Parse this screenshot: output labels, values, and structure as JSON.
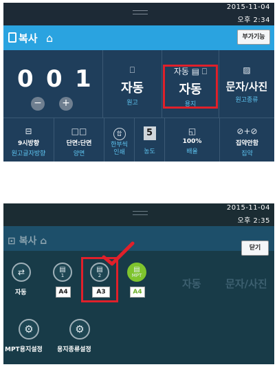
{
  "top": {
    "status": {
      "date": "2015-11-04",
      "time": "오후 2:34"
    },
    "header": {
      "title": "복사",
      "extra_button": "부가기능"
    },
    "counter": {
      "digit1": "0",
      "digit2": "0",
      "digit3": "1",
      "minus": "−",
      "plus": "+"
    },
    "row1": [
      {
        "icon": "⎕",
        "value": "자동",
        "label": "원고"
      },
      {
        "icon": "자동 ▤ ⎕",
        "value": "자동",
        "label": "용지"
      },
      {
        "icon": "▨",
        "value": "문자/사진",
        "label": "원고종류"
      }
    ],
    "row2": [
      {
        "icon": "⊟",
        "value": "9시방향",
        "label": "원고글자방향"
      },
      {
        "icon": "□□",
        "value": "단면:단면",
        "label": "양면"
      },
      {
        "icon": "합",
        "value": "한부씩\n인쇄",
        "label": "한부씩인쇄"
      },
      {
        "icon": "5",
        "value": "",
        "label": "농도"
      },
      {
        "icon": "◱",
        "value": "100%",
        "label": "배율"
      },
      {
        "icon": "⊘+⊘",
        "value": "집약안함",
        "label": "집약"
      }
    ]
  },
  "bottom": {
    "status": {
      "date": "2015-11-04",
      "time": "오후 2:35"
    },
    "ghost": {
      "title": "복사",
      "bg1": "자동",
      "bg2": "문자/사진"
    },
    "close_button": "닫기",
    "trays": [
      {
        "label": "자동",
        "num": ""
      },
      {
        "label": "A4",
        "num": "1"
      },
      {
        "label": "A3",
        "num": "2"
      },
      {
        "label": "A4",
        "num": "MPT"
      }
    ],
    "settings": [
      {
        "label": "MPT용지설정"
      },
      {
        "label": "용지종류설정"
      }
    ]
  },
  "colors": {
    "accent": "#2aa3e0",
    "highlight": "#e0202a",
    "mpt_green": "#7fc42e"
  }
}
